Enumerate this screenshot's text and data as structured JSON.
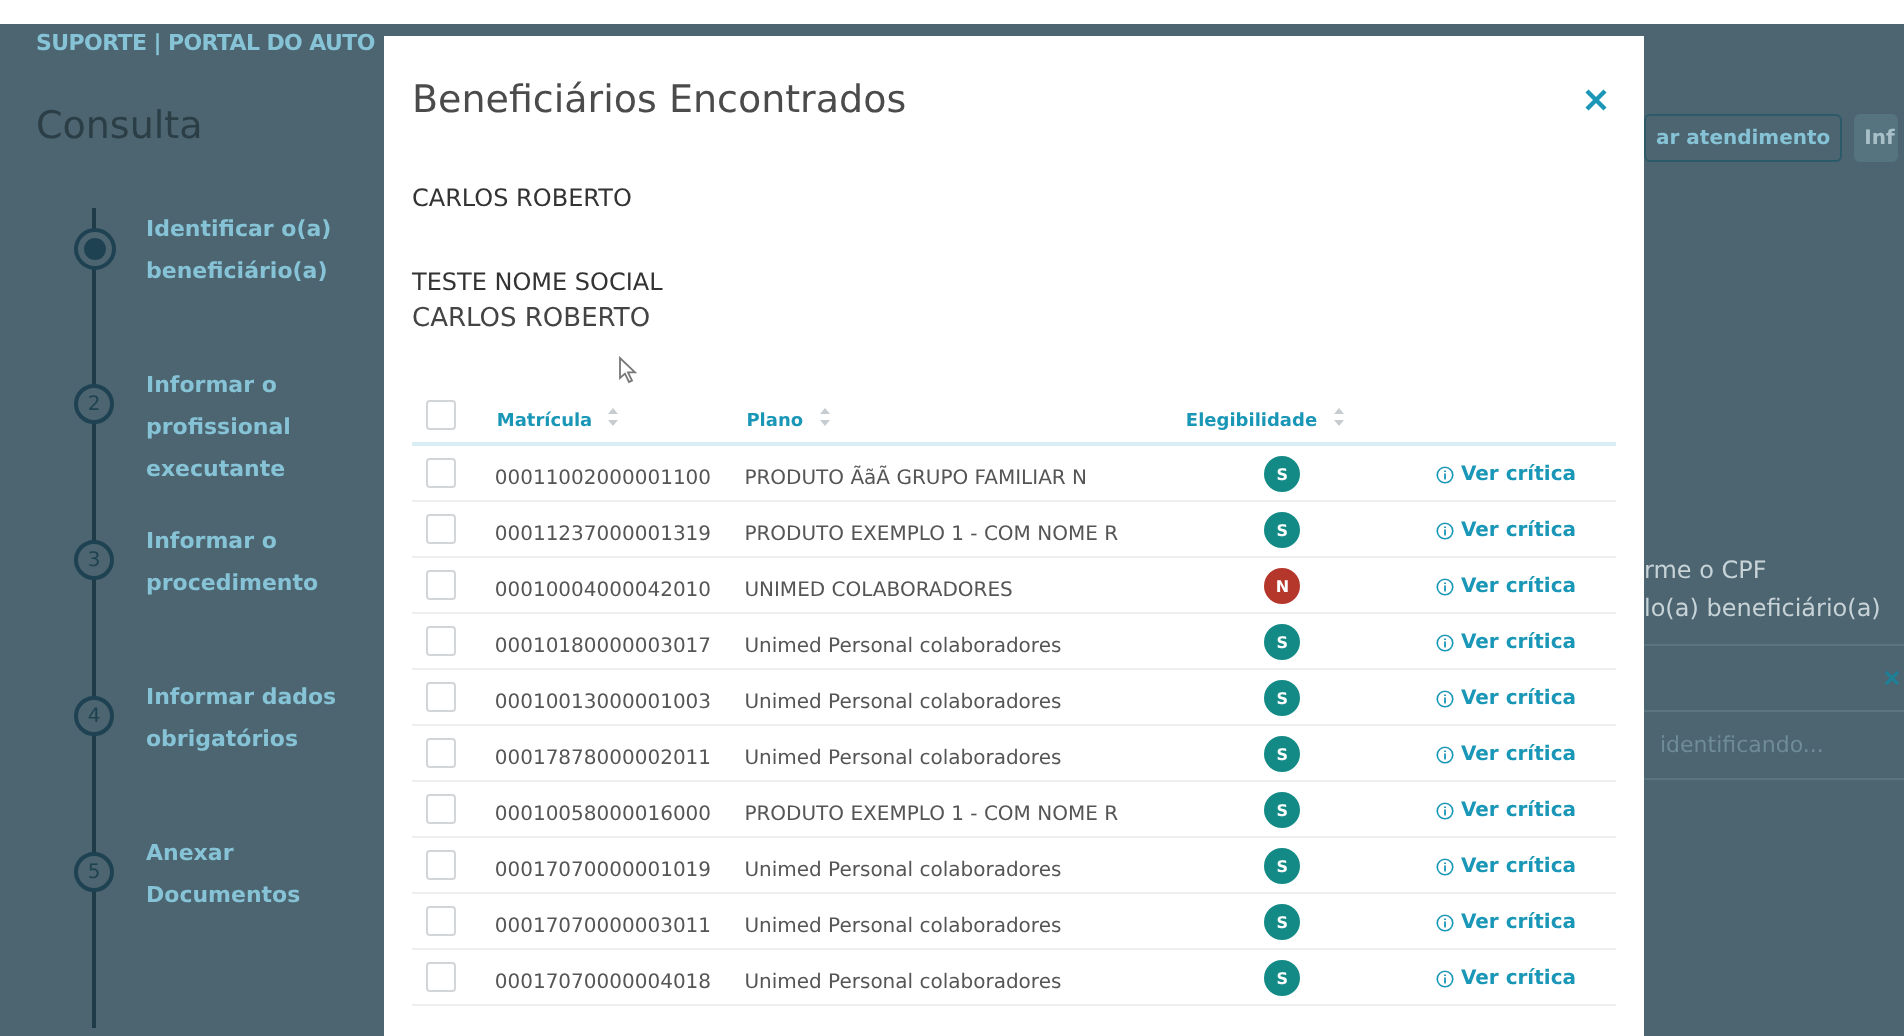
{
  "page": {
    "header": "SUPORTE | PORTAL DO AUTO",
    "title": "Consulta",
    "steps": [
      {
        "label": "Identificar o(a) beneficiário(a)",
        "selected": true
      },
      {
        "number": "2",
        "label": "Informar o profissional executante",
        "selected": false
      },
      {
        "number": "3",
        "label": "Informar o procedimento",
        "selected": false
      },
      {
        "number": "4",
        "label": "Informar dados obrigatórios",
        "selected": false
      },
      {
        "number": "5",
        "label": "Anexar Documentos",
        "selected": false
      }
    ],
    "buttons": [
      {
        "label": "ar atendimento",
        "kind": "outline"
      },
      {
        "label": "Inf",
        "kind": "filled"
      }
    ],
    "cpf_prompt": [
      "rme o CPF",
      "lo(a) beneficiário(a)"
    ],
    "search": {
      "placeholder": "identificando..."
    }
  },
  "modal": {
    "title": "Beneficiários Encontrados",
    "name": "CARLOS ROBERTO",
    "social_name_label": "TESTE NOME SOCIAL",
    "social_name": "CARLOS ROBERTO",
    "table": {
      "select_all_checked": false,
      "columns": [
        "Matrícula",
        "Plano",
        "Elegibilidade"
      ],
      "rows": [
        {
          "checked": false,
          "matricula": "00011002000001100",
          "plano": "PRODUTO ÃãÃ GRUPO FAMILIAR N",
          "elegibilidade": "S",
          "color": "#138a85",
          "link": "Ver crítica"
        },
        {
          "checked": false,
          "matricula": "00011237000001319",
          "plano": "PRODUTO EXEMPLO 1 - COM NOME R",
          "elegibilidade": "S",
          "color": "#138a85",
          "link": "Ver crítica"
        },
        {
          "checked": false,
          "matricula": "00010004000042010",
          "plano": "UNIMED COLABORADORES",
          "elegibilidade": "N",
          "color": "#b5372b",
          "link": "Ver crítica"
        },
        {
          "checked": false,
          "matricula": "00010180000003017",
          "plano": "Unimed Personal colaboradores",
          "elegibilidade": "S",
          "color": "#138a85",
          "link": "Ver crítica"
        },
        {
          "checked": false,
          "matricula": "00010013000001003",
          "plano": "Unimed Personal colaboradores",
          "elegibilidade": "S",
          "color": "#138a85",
          "link": "Ver crítica"
        },
        {
          "checked": false,
          "matricula": "00017878000002011",
          "plano": "Unimed Personal colaboradores",
          "elegibilidade": "S",
          "color": "#138a85",
          "link": "Ver crítica"
        },
        {
          "checked": false,
          "matricula": "00010058000016000",
          "plano": "PRODUTO EXEMPLO 1 - COM NOME R",
          "elegibilidade": "S",
          "color": "#138a85",
          "link": "Ver crítica"
        },
        {
          "checked": false,
          "matricula": "00017070000001019",
          "plano": "Unimed Personal colaboradores",
          "elegibilidade": "S",
          "color": "#138a85",
          "link": "Ver crítica"
        },
        {
          "checked": false,
          "matricula": "00017070000003011",
          "plano": "Unimed Personal colaboradores",
          "elegibilidade": "S",
          "color": "#138a85",
          "link": "Ver crítica"
        },
        {
          "checked": false,
          "matricula": "00017070000004018",
          "plano": "Unimed Personal colaboradores",
          "elegibilidade": "S",
          "color": "#138a85",
          "link": "Ver crítica"
        }
      ]
    }
  }
}
